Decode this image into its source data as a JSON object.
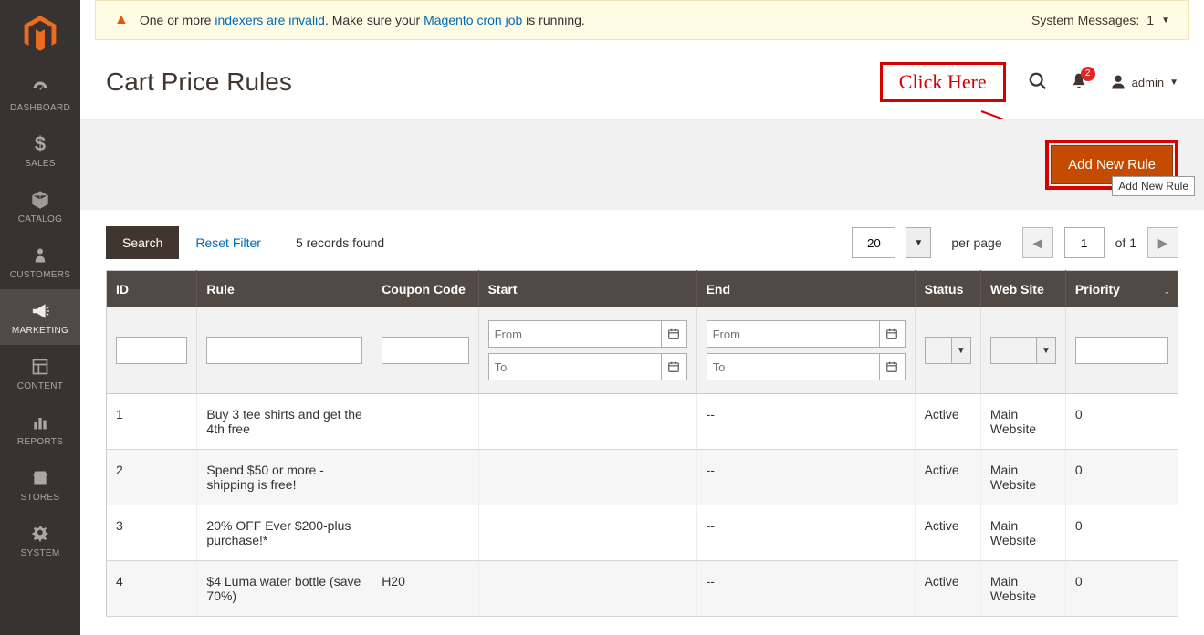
{
  "sidebar": {
    "items": [
      {
        "label": "DASHBOARD",
        "icon": "dashboard"
      },
      {
        "label": "SALES",
        "icon": "dollar"
      },
      {
        "label": "CATALOG",
        "icon": "box"
      },
      {
        "label": "CUSTOMERS",
        "icon": "person"
      },
      {
        "label": "MARKETING",
        "icon": "megaphone",
        "active": true
      },
      {
        "label": "CONTENT",
        "icon": "layout"
      },
      {
        "label": "REPORTS",
        "icon": "bars"
      },
      {
        "label": "STORES",
        "icon": "storefront"
      },
      {
        "label": "SYSTEM",
        "icon": "gear"
      }
    ]
  },
  "sysmsg": {
    "pre": "One or more ",
    "link1": "indexers are invalid",
    "mid": ". Make sure your ",
    "link2": "Magento cron job",
    "post": " is running.",
    "right_label": "System Messages:",
    "right_count": "1"
  },
  "header": {
    "title": "Cart Price Rules",
    "annotation": "Click Here",
    "notif_count": "2",
    "user": "admin"
  },
  "action": {
    "add_label": "Add New Rule",
    "tooltip": "Add New Rule"
  },
  "controls": {
    "search": "Search",
    "reset": "Reset Filter",
    "records": "5 records found",
    "perpage": "20",
    "perpage_label": "per page",
    "page": "1",
    "of": "of 1"
  },
  "columns": {
    "id": "ID",
    "rule": "Rule",
    "coupon": "Coupon Code",
    "start": "Start",
    "end": "End",
    "status": "Status",
    "website": "Web Site",
    "priority": "Priority"
  },
  "filters": {
    "from": "From",
    "to": "To"
  },
  "rows": [
    {
      "id": "1",
      "rule": "Buy 3 tee shirts and get the 4th free",
      "coupon": "",
      "start": "",
      "end": "--",
      "status": "Active",
      "website": "Main Website",
      "priority": "0"
    },
    {
      "id": "2",
      "rule": "Spend $50 or more - shipping is free!",
      "coupon": "",
      "start": "",
      "end": "--",
      "status": "Active",
      "website": "Main Website",
      "priority": "0"
    },
    {
      "id": "3",
      "rule": "20% OFF Ever $200-plus purchase!*",
      "coupon": "",
      "start": "",
      "end": "--",
      "status": "Active",
      "website": "Main Website",
      "priority": "0"
    },
    {
      "id": "4",
      "rule": "$4 Luma water bottle (save 70%)",
      "coupon": "H20",
      "start": "",
      "end": "--",
      "status": "Active",
      "website": "Main Website",
      "priority": "0"
    }
  ]
}
